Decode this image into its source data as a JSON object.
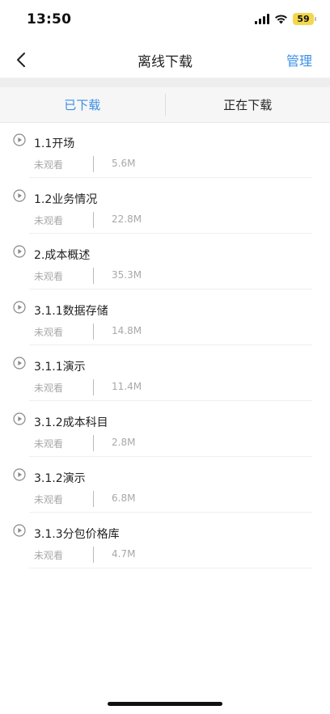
{
  "status_bar": {
    "time": "13:50",
    "battery": "59",
    "icons": [
      "signal-icon",
      "wifi-icon",
      "battery-icon"
    ]
  },
  "nav": {
    "title": "离线下载",
    "manage_label": "管理",
    "back_icon": "chevron-left-icon"
  },
  "tabs": [
    {
      "label": "已下载",
      "active": true
    },
    {
      "label": "正在下载",
      "active": false
    }
  ],
  "colors": {
    "accent": "#3a8ee6",
    "muted": "#a8a8a8",
    "battery": "#f5d84a"
  },
  "items": [
    {
      "title": "1.1开场",
      "status": "未观看",
      "size": "5.6M"
    },
    {
      "title": "1.2业务情况",
      "status": "未观看",
      "size": "22.8M"
    },
    {
      "title": "2.成本概述",
      "status": "未观看",
      "size": "35.3M"
    },
    {
      "title": "3.1.1数据存储",
      "status": "未观看",
      "size": "14.8M"
    },
    {
      "title": "3.1.1演示",
      "status": "未观看",
      "size": "11.4M"
    },
    {
      "title": "3.1.2成本科目",
      "status": "未观看",
      "size": "2.8M"
    },
    {
      "title": "3.1.2演示",
      "status": "未观看",
      "size": "6.8M"
    },
    {
      "title": "3.1.3分包价格库",
      "status": "未观看",
      "size": "4.7M"
    }
  ]
}
